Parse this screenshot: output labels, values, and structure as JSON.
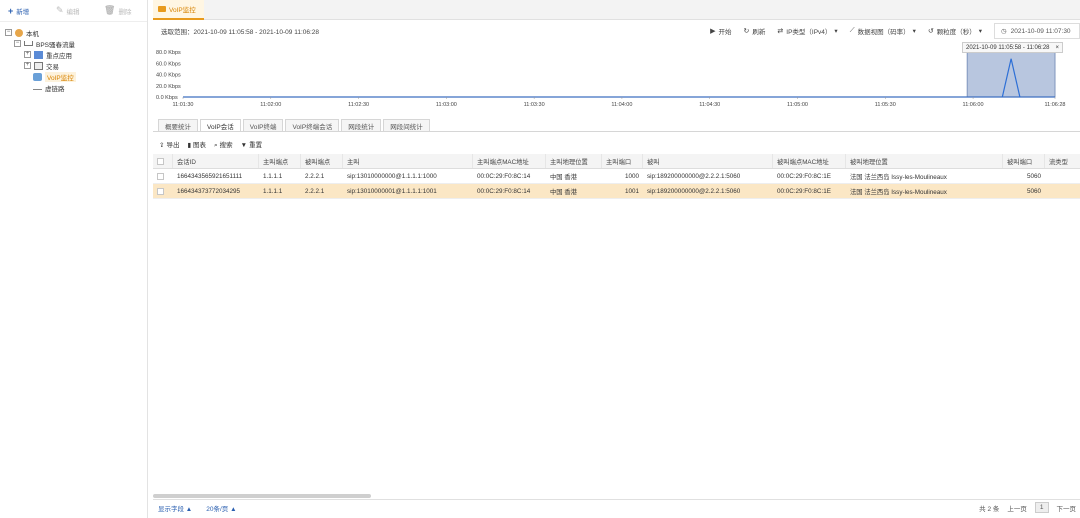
{
  "left_toolbar": {
    "new_label": "新增",
    "edit_label": "编辑",
    "delete_label": "删除"
  },
  "tree": {
    "root": "本机",
    "group": "BPS骚春流量",
    "items": [
      "重点应用",
      "交易",
      "VoIP监控",
      "虚链路"
    ]
  },
  "tab": {
    "title": "VoIP监控"
  },
  "range": {
    "text": "选取范围：2021-10-09 11:05:58 - 2021-10-09 11:06:28"
  },
  "tools": {
    "start": "开始",
    "refresh": "刷新",
    "ip_type": "IP类型（IPv4）",
    "data_view": "数据视图（码率）",
    "granularity": "颗粒度（秒）",
    "current_time": "2021-10-09 11:07:30"
  },
  "zoom": {
    "range": "2021-10-09 11:05:58 - 11:06:28",
    "close": "×"
  },
  "chart_data": {
    "type": "line",
    "y_ticks": [
      "80.0 Kbps",
      "60.0 Kbps",
      "40.0 Kbps",
      "20.0 Kbps",
      "0.0 Kbps"
    ],
    "ylim": [
      0,
      80
    ],
    "x_ticks": [
      "11:01:30",
      "11:02:00",
      "11:02:30",
      "11:03:00",
      "11:03:30",
      "11:04:00",
      "11:04:30",
      "11:05:00",
      "11:05:30",
      "11:06:00",
      "11:06:28"
    ],
    "series": [
      {
        "x": [
          "11:06:10",
          "11:06:13",
          "11:06:16"
        ],
        "values": [
          0,
          68,
          0
        ]
      }
    ],
    "selection": [
      "11:05:58",
      "11:06:28"
    ]
  },
  "sub_tabs": [
    "概要统计",
    "VoIP会话",
    "VoIP终端",
    "VoIP终端会话",
    "网段统计",
    "网段间统计"
  ],
  "actions": {
    "export": "导出",
    "chart": "图表",
    "search": "搜索",
    "reset": "重置"
  },
  "table": {
    "headers": [
      "会话ID",
      "主叫端点",
      "被叫端点",
      "主叫",
      "主叫端点MAC地址",
      "主叫地理位置",
      "主叫端口",
      "被叫",
      "被叫端点MAC地址",
      "被叫地理位置",
      "被叫端口",
      "流类型"
    ],
    "rows": [
      [
        "1664343565921651111",
        "1.1.1.1",
        "2.2.2.1",
        "sip:13010000000@1.1.1.1:1000",
        "00:0C:29:F0:8C:14",
        "中国 香港",
        "1000",
        "sip:189200000000@2.2.2.1:5060",
        "00:0C:29:F0:8C:1E",
        "法国 法兰西岛 Issy-les-Moulineaux",
        "5060",
        ""
      ],
      [
        "16643437377203429​5",
        "1.1.1.1",
        "2.2.2.1",
        "sip:13010000001@1.1.1.1:1001",
        "00:0C:29:F0:8C:14",
        "中国 香港",
        "1001",
        "sip:189200000000@2.2.2.1:5060",
        "00:0C:29:F0:8C:1E",
        "法国 法兰西岛 Issy-les-Moulineaux",
        "5060",
        ""
      ]
    ]
  },
  "footer": {
    "show_fields": "显示字段 ▲",
    "page_size": "20条/页 ▲",
    "total": "共 2 条",
    "prev": "上一页",
    "page": "1",
    "next": "下一页"
  }
}
